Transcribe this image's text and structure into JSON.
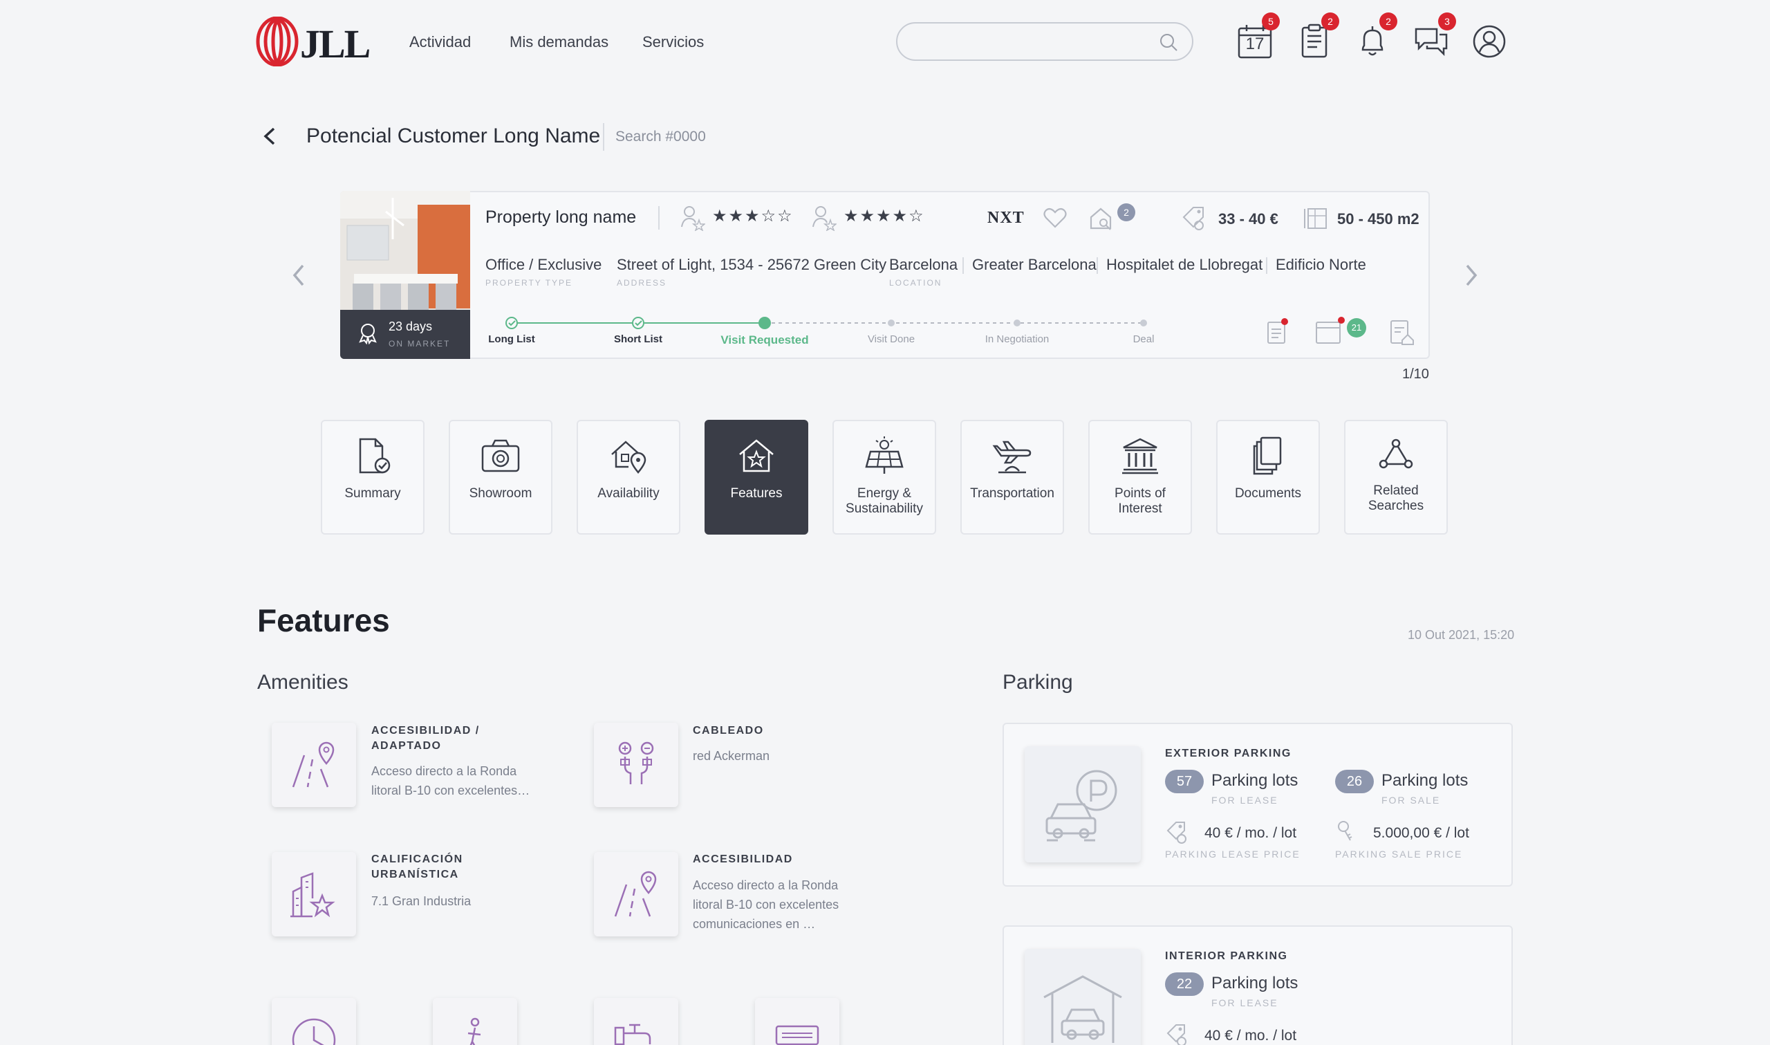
{
  "header": {
    "logo": "JLL",
    "nav": [
      "Actividad",
      "Mis demandas",
      "Servicios"
    ],
    "search_placeholder": "",
    "icons": [
      {
        "name": "calendar-icon",
        "badge": "5",
        "day": "17"
      },
      {
        "name": "tasks-icon",
        "badge": "2"
      },
      {
        "name": "bell-icon",
        "badge": "2"
      },
      {
        "name": "chat-icon",
        "badge": "3"
      },
      {
        "name": "user-icon",
        "badge": ""
      }
    ]
  },
  "title_row": {
    "customer": "Potencial Customer Long Name",
    "search_no": "Search #0000"
  },
  "property": {
    "name": "Property long name",
    "agent_rating": "★★★☆☆",
    "client_rating": "★★★★☆",
    "brand": "NXT",
    "visits_count": "2",
    "price": "33 - 40 €",
    "area": "50 - 450 m2",
    "days_on_market": "23 days",
    "days_label": "ON MARKET",
    "type": "Office / Exclusive",
    "type_label": "PROPERTY TYPE",
    "address": "Street of Light, 1534 - 25672 Green City",
    "address_label": "ADDRESS",
    "location": [
      "Barcelona",
      "Greater Barcelona",
      "Hospitalet de Llobregat",
      "Edificio Norte"
    ],
    "location_label": "LOCATION",
    "stages": [
      "Long List",
      "Short List",
      "Visit Requested",
      "Visit Done",
      "In Negotiation",
      "Deal"
    ],
    "calendar_count": "21",
    "counter": "1/10"
  },
  "tabs": [
    {
      "label": "Summary"
    },
    {
      "label": "Showroom"
    },
    {
      "label": "Availability"
    },
    {
      "label": "Features"
    },
    {
      "label": "Energy &\nSustainability"
    },
    {
      "label": "Transportation"
    },
    {
      "label": "Points of\nInterest"
    },
    {
      "label": "Documents"
    },
    {
      "label": "Related\nSearches"
    }
  ],
  "features": {
    "title": "Features",
    "date": "10 Out 2021, 15:20",
    "amenities_title": "Amenities",
    "amenities": [
      {
        "title": "ACCESIBILIDAD / ADAPTADO",
        "desc": "Acceso directo a la Ronda litoral B-10 con excelentes…"
      },
      {
        "title": "CABLEADO",
        "desc": "red Ackerman"
      },
      {
        "title": "CALIFICACIÓN URBANÍSTICA",
        "desc": "7.1 Gran Industria"
      },
      {
        "title": "ACCESIBILIDAD",
        "desc": "Acceso directo a la Ronda litoral B-10 con excelentes comunicaciones en …"
      }
    ],
    "parking_title": "Parking",
    "exterior": {
      "type": "EXTERIOR PARKING",
      "lease_count": "57",
      "lease_label": "Parking lots",
      "lease_sub": "FOR LEASE",
      "sale_count": "26",
      "sale_label": "Parking lots",
      "sale_sub": "FOR SALE",
      "lease_price": "40 € / mo. / lot",
      "lease_price_label": "PARKING LEASE PRICE",
      "sale_price": "5.000,00 € / lot",
      "sale_price_label": "PARKING SALE PRICE"
    },
    "interior": {
      "type": "INTERIOR PARKING",
      "lease_count": "22",
      "lease_label": "Parking lots",
      "lease_sub": "FOR LEASE",
      "lease_price": "40 € / mo. / lot"
    }
  },
  "colors": {
    "accent_green": "#5cb88a",
    "badge_red": "#d9252f",
    "dark": "#3a3d47",
    "purple": "#9b6fb5"
  }
}
